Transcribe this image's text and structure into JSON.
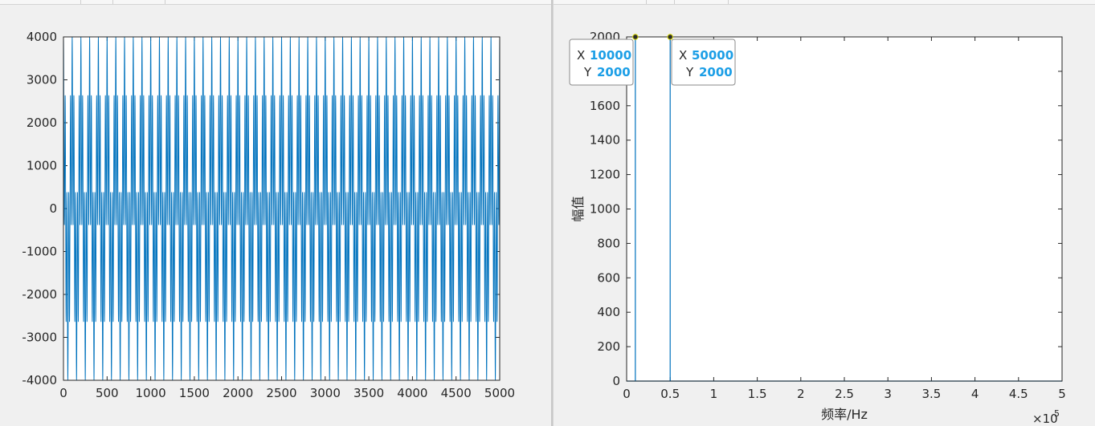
{
  "chart_data": [
    {
      "type": "line",
      "title": "",
      "xlabel": "",
      "ylabel": "",
      "xlim": [
        0,
        5000
      ],
      "ylim": [
        -4000,
        4000
      ],
      "x_ticks": [
        0,
        500,
        1000,
        1500,
        2000,
        2500,
        3000,
        3500,
        4000,
        4500,
        5000
      ],
      "y_ticks": [
        -4000,
        -3000,
        -2000,
        -1000,
        0,
        1000,
        2000,
        3000,
        4000
      ],
      "x_tick_labels": [
        "0",
        "500",
        "1000",
        "1500",
        "2000",
        "2500",
        "3000",
        "3500",
        "4000",
        "4500",
        "5000"
      ],
      "y_tick_labels": [
        "-4000",
        "-3000",
        "-2000",
        "-1000",
        "0",
        "1000",
        "2000",
        "3000",
        "4000"
      ],
      "grid": false,
      "series": [
        {
          "description": "time-domain signal, sum of two cosines",
          "amplitudes": [
            2000,
            2000
          ],
          "periods_in_samples": [
            100,
            20
          ],
          "sample_count": 5000,
          "color": "#0072bd"
        }
      ]
    },
    {
      "type": "line",
      "title": "",
      "xlabel": "频率/Hz",
      "ylabel": "幅值",
      "xlim": [
        0,
        500000
      ],
      "ylim": [
        0,
        2000
      ],
      "x_exponent_label": "×10",
      "x_exponent_power": "5",
      "x_ticks": [
        0,
        50000,
        100000,
        150000,
        200000,
        250000,
        300000,
        350000,
        400000,
        450000,
        500000
      ],
      "x_tick_labels": [
        "0",
        "0.5",
        "1",
        "1.5",
        "2",
        "2.5",
        "3",
        "3.5",
        "4",
        "4.5",
        "5"
      ],
      "y_ticks": [
        0,
        200,
        400,
        600,
        800,
        1000,
        1200,
        1400,
        1600,
        1800,
        2000
      ],
      "y_tick_labels": [
        "0",
        "200",
        "400",
        "600",
        "800",
        "1000",
        "1200",
        "1400",
        "1600",
        "1800",
        "2000"
      ],
      "grid": false,
      "series": [
        {
          "description": "magnitude spectrum",
          "x": [
            0,
            10000,
            50000,
            500000
          ],
          "y": [
            0,
            2000,
            2000,
            0
          ],
          "color": "#0072bd"
        }
      ],
      "datatips": [
        {
          "x_key": "X",
          "x": "10000",
          "y_key": "Y",
          "y": "2000"
        },
        {
          "x_key": "X",
          "x": "50000",
          "y_key": "Y",
          "y": "2000"
        }
      ]
    }
  ]
}
